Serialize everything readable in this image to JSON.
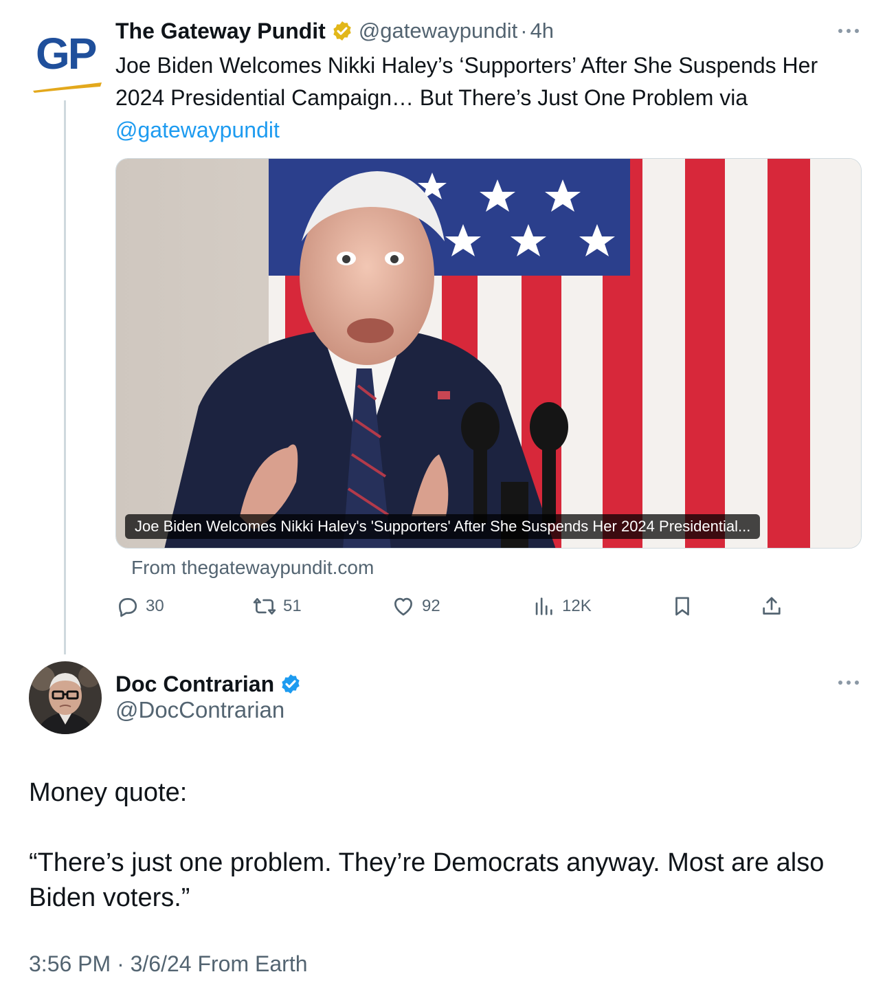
{
  "parent_tweet": {
    "avatar_text": "GP",
    "display_name": "The Gateway Pundit",
    "handle": "@gatewaypundit",
    "separator": "·",
    "age": "4h",
    "text_lines": [
      "Joe Biden Welcomes Nikki Haley’s ‘Supporters’ After She Suspends Her",
      "2024 Presidential Campaign… But There’s Just One Problem via"
    ],
    "text_mention": "@gatewaypundit",
    "card": {
      "image_icon": "article-photo",
      "caption": "Joe Biden Welcomes Nikki Haley's 'Supporters' After She Suspends Her 2024 Presidential...",
      "source": "From thegatewaypundit.com"
    },
    "actions": {
      "replies": "30",
      "reposts": "51",
      "likes": "92",
      "views": "12K"
    },
    "verified_badge_color": "#e2b719"
  },
  "reply_tweet": {
    "display_name": "Doc Contrarian",
    "handle": "@DocContrarian",
    "verified_badge_color": "#1d9bf0",
    "body_line_1": "Money quote:",
    "body_quote_lines": [
      "“There’s just one problem. They’re Democrats anyway. Most are also",
      "Biden voters.”"
    ],
    "timestamp": "3:56 PM · 3/6/24 From Earth"
  },
  "colors": {
    "text_primary": "#0f1419",
    "text_secondary": "#536471",
    "link": "#1d9bf0",
    "thread_line": "#cfd9de"
  }
}
